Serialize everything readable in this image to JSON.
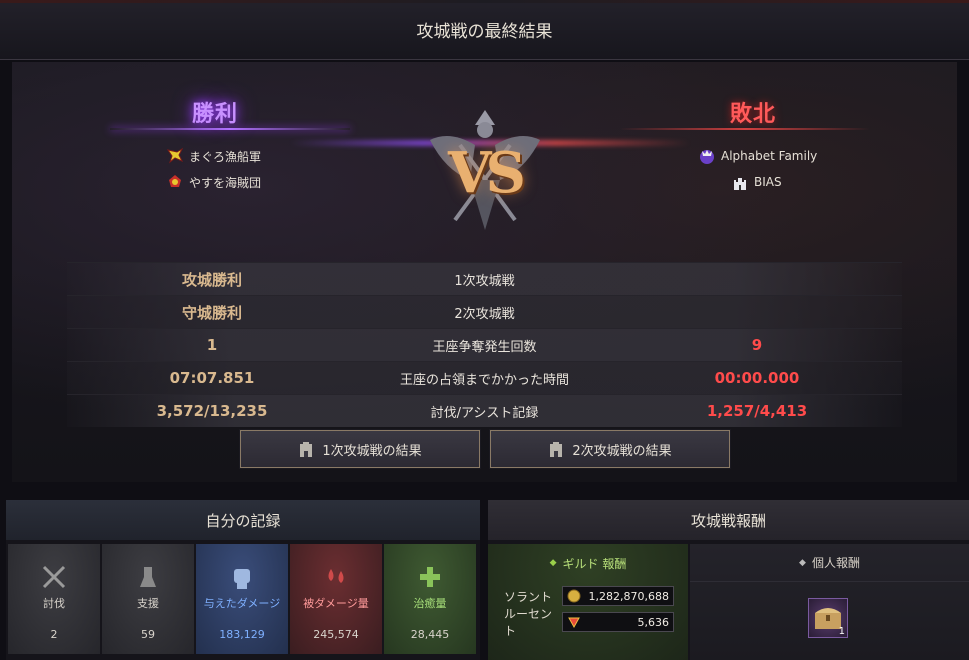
{
  "header": {
    "title": "攻城戦の最終結果"
  },
  "result": {
    "winner": {
      "label": "勝利",
      "guilds": [
        {
          "name": "まぐろ漁船軍",
          "icon": "yellow-bird-emblem-icon"
        },
        {
          "name": "やすを海賊団",
          "icon": "pirate-emblem-icon"
        }
      ]
    },
    "loser": {
      "label": "敗北",
      "guilds": [
        {
          "name": "Alphabet Family",
          "icon": "crowned-emblem-icon"
        },
        {
          "name": "BIAS",
          "icon": "castle-emblem-icon"
        }
      ]
    },
    "vs_label": "VS"
  },
  "stats": [
    {
      "left": "攻城勝利",
      "center": "1次攻城戦",
      "right": ""
    },
    {
      "left": "守城勝利",
      "center": "2次攻城戦",
      "right": ""
    },
    {
      "left": "1",
      "center": "王座争奪発生回数",
      "right": "9"
    },
    {
      "left": "07:07.851",
      "center": "王座の占領までかかった時間",
      "right": "00:00.000"
    },
    {
      "left": "3,572/13,235",
      "center": "討伐/アシスト記録",
      "right": "1,257/4,413"
    }
  ],
  "buttons": {
    "round1": "1次攻城戦の結果",
    "round2": "2次攻城戦の結果"
  },
  "my_record": {
    "title": "自分の記録",
    "items": [
      {
        "label": "討伐",
        "value": "2",
        "icon": "crossed-swords-icon",
        "color": "gray"
      },
      {
        "label": "支援",
        "value": "59",
        "icon": "shield-figure-icon",
        "color": "gray"
      },
      {
        "label": "与えたダメージ",
        "value": "183,129",
        "icon": "fist-icon",
        "color": "blue"
      },
      {
        "label": "被ダメージ量",
        "value": "245,574",
        "icon": "blood-drops-icon",
        "color": "red"
      },
      {
        "label": "治癒量",
        "value": "28,445",
        "icon": "heal-cross-icon",
        "color": "green"
      }
    ]
  },
  "rewards": {
    "title": "攻城戦報酬",
    "guild": {
      "title": "ギルド 報酬",
      "rows": [
        {
          "label": "ソラント",
          "value": "1,282,870,688",
          "icon": "coin-icon"
        },
        {
          "label": "ルーセント",
          "value": "5,636",
          "icon": "lucent-icon"
        }
      ]
    },
    "personal": {
      "title": "個人報酬",
      "item_count": "1",
      "item_icon": "treasure-chest-icon"
    }
  },
  "colors": {
    "win": "#c890ff",
    "lose": "#ff4b4b",
    "stat_left": "#d9b98f",
    "damage_dealt": "#7fb0ff"
  }
}
